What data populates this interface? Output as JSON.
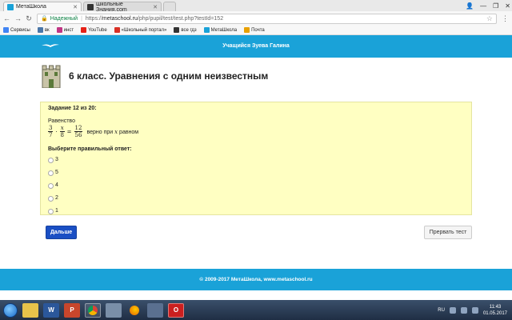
{
  "browser": {
    "tabs": [
      {
        "label": "МетаШкола",
        "active": true,
        "favicon_color": "#1aa2d8"
      },
      {
        "label": "Школьные Знания.com",
        "active": false,
        "favicon_color": "#333333"
      }
    ],
    "secure_label": "Надежный",
    "url_prefix": "https://",
    "url_host": "metaschool.ru",
    "url_path": "/php/pupil/test/test.php?testId=152",
    "bookmarks": [
      {
        "label": "Сервисы",
        "color": "#4285f4"
      },
      {
        "label": "вк",
        "color": "#4a76a8"
      },
      {
        "label": "инст",
        "color": "#c13584"
      },
      {
        "label": "YouTube",
        "color": "#e62117"
      },
      {
        "label": "«Школьный портал»",
        "color": "#d93025"
      },
      {
        "label": "все гдз",
        "color": "#333333"
      },
      {
        "label": "МетаШкола",
        "color": "#1aa2d8"
      },
      {
        "label": "Почта",
        "color": "#e8a000"
      }
    ]
  },
  "header": {
    "user_label": "Учащийся  Зуева Галина",
    "brand_color": "#1aa2d8"
  },
  "page": {
    "title": "6 класс. Уравнения с одним неизвестным"
  },
  "task": {
    "counter": "Задание 12 из 20:",
    "statement_intro": "Равенство",
    "formula": {
      "f1_num": "3",
      "f1_den": "7",
      "op1": "·",
      "f2_num": "x",
      "f2_den": "8",
      "eq": "=",
      "f3_num": "12",
      "f3_den": "56",
      "tail_before": "верно при",
      "tail_var": "x",
      "tail_after": "равном"
    },
    "prompt": "Выберите правильный ответ:",
    "options": [
      "3",
      "5",
      "4",
      "2",
      "1"
    ]
  },
  "actions": {
    "next_label": "Дальше",
    "stop_label": "Прервать тест",
    "next_color": "#1a4fc4"
  },
  "footer": {
    "text": "© 2009-2017 МетаШкола, www.metaschool.ru"
  },
  "taskbar": {
    "lang": "RU",
    "time": "11:43",
    "date": "01.05.2017"
  }
}
